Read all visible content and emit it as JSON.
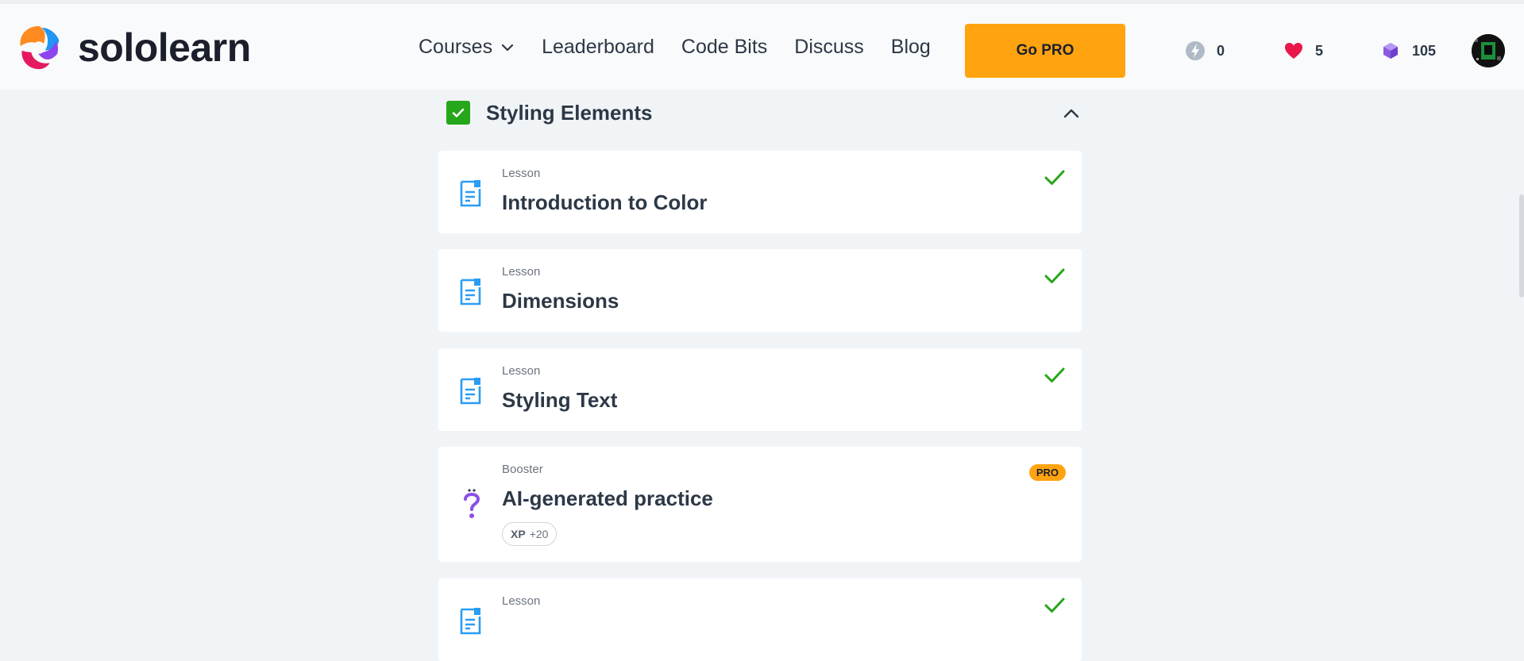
{
  "header": {
    "logo_text": "sololearn",
    "nav": [
      {
        "label": "Courses"
      },
      {
        "label": "Leaderboard"
      },
      {
        "label": "Code Bits"
      },
      {
        "label": "Discuss"
      },
      {
        "label": "Blog"
      }
    ],
    "go_pro_label": "Go PRO",
    "stats": {
      "energy": "0",
      "hearts": "5",
      "gems": "105"
    },
    "colors": {
      "accent": "#ffa310",
      "heart": "#e8194a",
      "gem": "#8a5be0",
      "energy": "#b0bac6"
    }
  },
  "section": {
    "title": "Styling Elements",
    "completed": true
  },
  "items": [
    {
      "kind": "Lesson",
      "title": "Introduction to Color",
      "icon": "lesson-doc-icon",
      "completed": true
    },
    {
      "kind": "Lesson",
      "title": "Dimensions",
      "icon": "lesson-doc-icon",
      "completed": true
    },
    {
      "kind": "Lesson",
      "title": "Styling Text",
      "icon": "lesson-doc-icon",
      "completed": true
    },
    {
      "kind": "Booster",
      "title": "AI-generated practice",
      "icon": "question-mark-icon",
      "badge": "PRO",
      "xp_label": "XP",
      "xp_value": "+20"
    },
    {
      "kind": "Lesson",
      "title": "",
      "icon": "lesson-doc-icon",
      "completed": true
    }
  ]
}
